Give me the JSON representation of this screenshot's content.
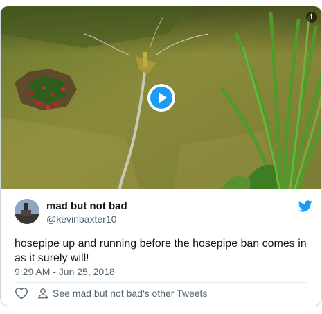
{
  "tweet": {
    "display_name": "mad but not bad",
    "handle": "@kevinbaxter10",
    "text": "hosepipe up and running before the hosepipe ban comes in as it surely will!",
    "timestamp": "9:29 AM - Jun 25, 2018",
    "other_tweets_link": "See mad but not bad's other Tweets"
  },
  "media": {
    "type": "video",
    "info_badge": "i"
  },
  "colors": {
    "accent": "#1d9bf0",
    "text": "#0f1419",
    "muted": "#536471"
  },
  "icons": {
    "play": "play-icon",
    "info": "info-icon",
    "brand": "twitter-bird-icon",
    "like": "heart-icon",
    "profile": "person-icon"
  }
}
